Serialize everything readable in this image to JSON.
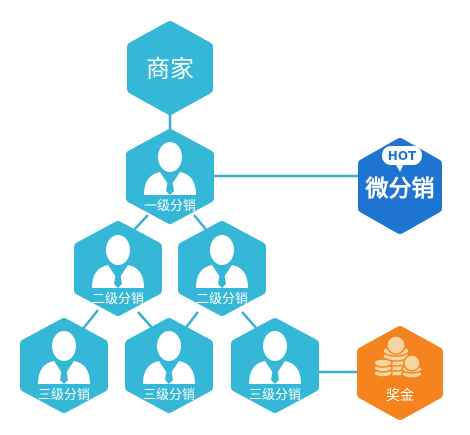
{
  "colors": {
    "hex_fill": "#35b8d7",
    "connector": "#3aaed3",
    "microdist_fill": "#1e74d1",
    "bonus_fill": "#f5841f",
    "coin": "#f6d5a3"
  },
  "nodes": {
    "merchant": {
      "label": "商家"
    },
    "level1": {
      "label": "一级分销"
    },
    "level2": [
      {
        "label": "二级分销"
      },
      {
        "label": "二级分销"
      }
    ],
    "level3": [
      {
        "label": "三级分销"
      },
      {
        "label": "三级分销"
      },
      {
        "label": "三级分销"
      }
    ]
  },
  "badges": {
    "microdist": {
      "hot": "HOT",
      "title": "微分销"
    },
    "bonus": {
      "label": "奖金"
    }
  },
  "icons": {
    "person": "person-icon",
    "coins": "coin-stack-icon"
  }
}
